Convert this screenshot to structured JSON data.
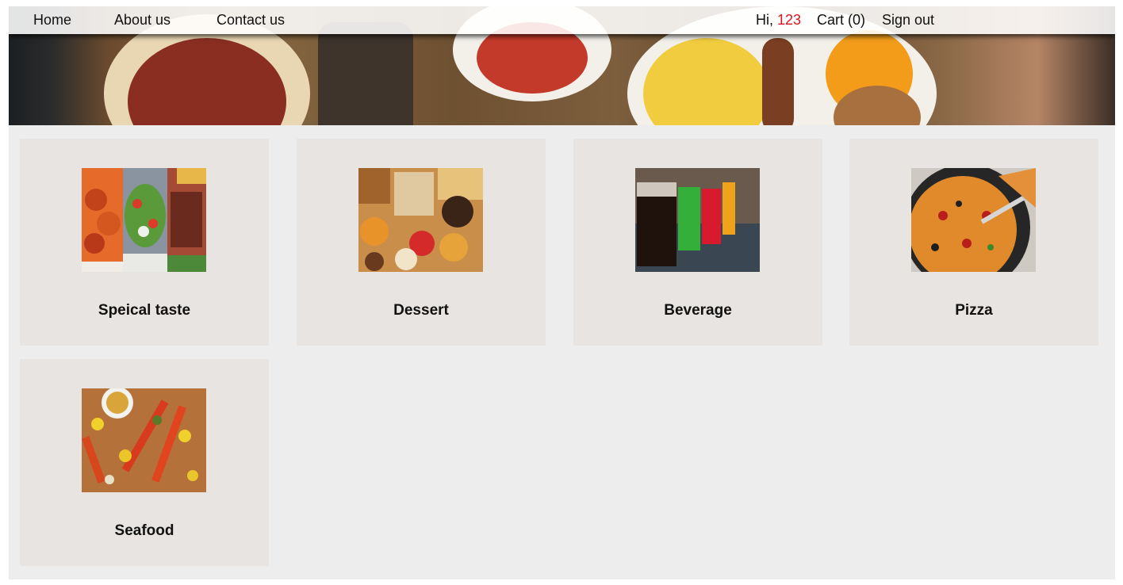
{
  "nav": {
    "links": [
      "Home",
      "About us",
      "Contact us"
    ],
    "greeting_prefix": "Hi,",
    "username": "123",
    "cart": "Cart (0)",
    "sign_out": "Sign out"
  },
  "colors": {
    "username": "#e0141e",
    "card_bg": "#e8e4e1",
    "page_bg": "#ededed"
  },
  "categories": [
    {
      "title": "Speical taste",
      "image": "special-taste-food-photo"
    },
    {
      "title": "Dessert",
      "image": "dessert-platter-photo"
    },
    {
      "title": "Beverage",
      "image": "colorful-drinks-photo"
    },
    {
      "title": "Pizza",
      "image": "pizza-photo"
    },
    {
      "title": "Seafood",
      "image": "seafood-boil-photo"
    }
  ]
}
